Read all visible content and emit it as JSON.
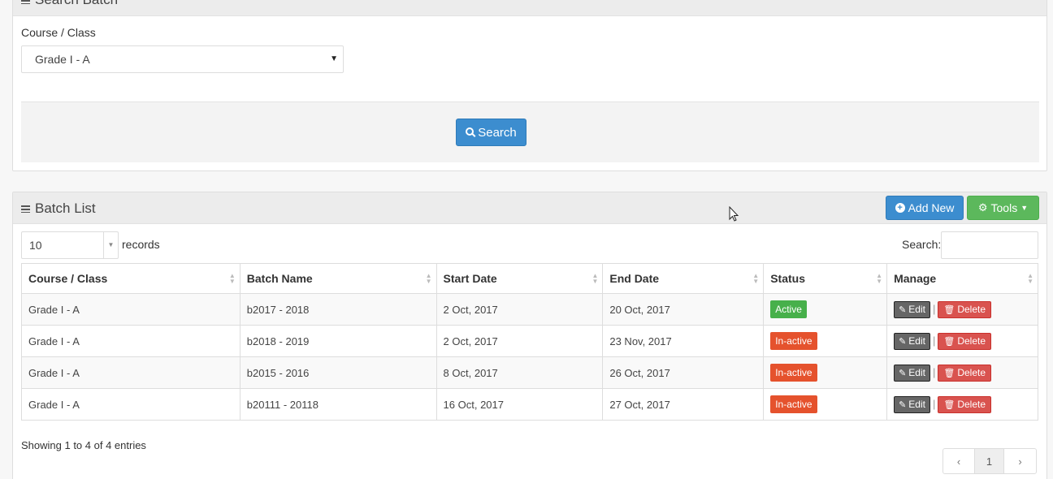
{
  "search_panel": {
    "title": "Search Batch",
    "course_label": "Course / Class",
    "course_value": "Grade I - A",
    "search_button": "Search"
  },
  "list_panel": {
    "title": "Batch List",
    "add_button": "Add New",
    "tools_button": "Tools",
    "page_length": "10",
    "records_label": "records",
    "search_label": "Search:",
    "columns": [
      "Course / Class",
      "Batch Name",
      "Start Date",
      "End Date",
      "Status",
      "Manage"
    ],
    "rows": [
      {
        "course": "Grade I - A",
        "batch": "b2017 - 2018",
        "start": "2 Oct, 2017",
        "end": "20 Oct, 2017",
        "status": "Active"
      },
      {
        "course": "Grade I - A",
        "batch": "b2018 - 2019",
        "start": "2 Oct, 2017",
        "end": "23 Nov, 2017",
        "status": "In-active"
      },
      {
        "course": "Grade I - A",
        "batch": "b2015 - 2016",
        "start": "8 Oct, 2017",
        "end": "26 Oct, 2017",
        "status": "In-active"
      },
      {
        "course": "Grade I - A",
        "batch": "b20111 - 20118",
        "start": "16 Oct, 2017",
        "end": "27 Oct, 2017",
        "status": "In-active"
      }
    ],
    "edit_label": "Edit",
    "delete_label": "Delete",
    "info": "Showing 1 to 4 of 4 entries",
    "pagination": {
      "prev": "‹",
      "current": "1",
      "next": "›"
    }
  },
  "colors": {
    "primary": "#3c8dcf",
    "success": "#5cb85c",
    "active": "#47b04b",
    "inactive": "#e5522d",
    "danger": "#d9534f"
  },
  "icons": [
    "menu-icon",
    "search-icon",
    "plus-circle-icon",
    "gears-icon",
    "chevron-down-icon",
    "edit-icon",
    "trash-icon",
    "sort-icon"
  ]
}
